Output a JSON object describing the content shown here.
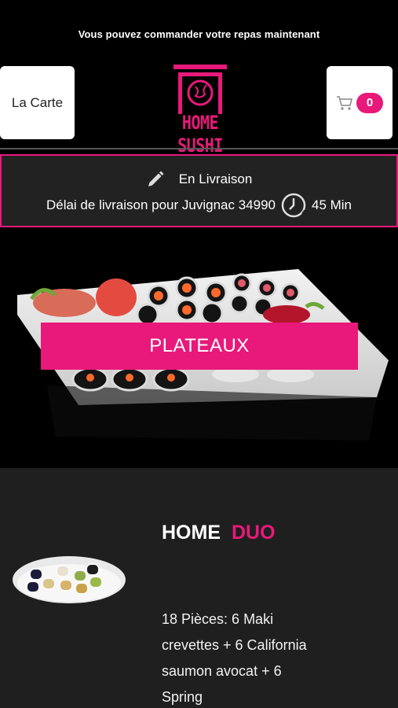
{
  "notice": "Vous pouvez commander votre repas maintenant",
  "header": {
    "menu_label": "La Carte",
    "cart_count": "0",
    "logo_text": "HOME SUSHI"
  },
  "delivery": {
    "mode": "En Livraison",
    "delay_text": "Délai de livraison pour Juvignac 34990",
    "delay_time": "45 Min"
  },
  "hero": {
    "category_label": "PLATEAUX"
  },
  "product": {
    "title_part1": "HOME",
    "title_part2": "DUO",
    "description": "18 Pièces: 6 Maki crevettes + 6 California saumon avocat + 6 Spring"
  },
  "colors": {
    "accent": "#e8197a",
    "background": "#000000",
    "panel": "#1f1f1f"
  },
  "icons": [
    "pencil-icon",
    "clock-icon",
    "cart-icon",
    "torii-logo-icon"
  ]
}
